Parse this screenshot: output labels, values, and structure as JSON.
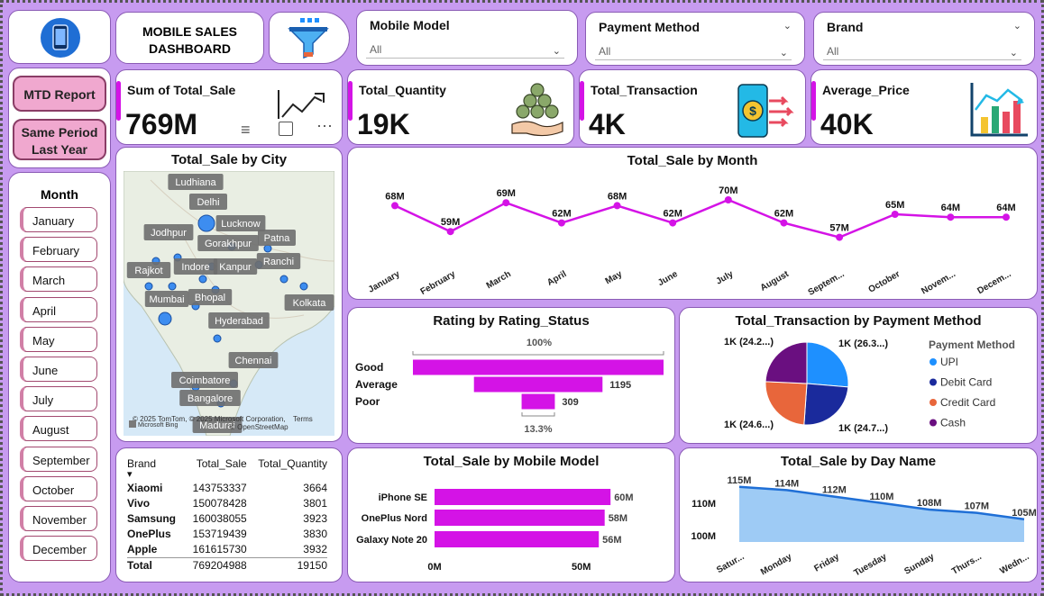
{
  "header": {
    "title_line1": "MOBILE SALES",
    "title_line2": "DASHBOARD"
  },
  "slicers": [
    {
      "label": "Mobile Model",
      "value": "All"
    },
    {
      "label": "Payment Method",
      "value": "All"
    },
    {
      "label": "Brand",
      "value": "All"
    }
  ],
  "nav": {
    "mtd": "MTD Report",
    "spl_line1": "Same Period",
    "spl_line2": "Last Year"
  },
  "month_slicer": {
    "title": "Month",
    "items": [
      "January",
      "February",
      "March",
      "April",
      "May",
      "June",
      "July",
      "August",
      "September",
      "October",
      "November",
      "December"
    ]
  },
  "kpis": [
    {
      "label": "Sum of Total_Sale",
      "value": "769M",
      "icon": "trend-chart-icon"
    },
    {
      "label": "Total_Quantity",
      "value": "19K",
      "icon": "coins-hand-icon"
    },
    {
      "label": "Total_Transaction",
      "value": "4K",
      "icon": "phone-transfer-icon"
    },
    {
      "label": "Average_Price",
      "value": "40K",
      "icon": "bar-growth-icon"
    }
  ],
  "map": {
    "title": "Total_Sale by City",
    "attribution": "© 2025 TomTom, © 2025 Microsoft Corporation,",
    "terms": "Terms",
    "osm": "© OpenStreetMap",
    "bing": "Microsoft Bing",
    "cities": [
      "Ludhiana",
      "Delhi",
      "Lucknow",
      "Jodhpur",
      "Gorakhpur",
      "Patna",
      "Ranchi",
      "Rajkot",
      "Indore",
      "Kanpur",
      "Mumbai",
      "Bhopal",
      "Kolkata",
      "Hyderabad",
      "Chennai",
      "Coimbatore",
      "Bangalore",
      "Madurai"
    ]
  },
  "colors": {
    "accent": "#d413e6",
    "pie": [
      "#1e90ff",
      "#1a2a9c",
      "#e8663b",
      "#6a0f80"
    ],
    "area": "#9ecbf5",
    "area_line": "#1f6fd6"
  },
  "chart_data": [
    {
      "type": "line",
      "title": "Total_Sale by Month",
      "categories": [
        "January",
        "February",
        "March",
        "April",
        "May",
        "June",
        "July",
        "August",
        "Septem...",
        "October",
        "Novem...",
        "Decem..."
      ],
      "values": [
        68,
        59,
        69,
        62,
        68,
        62,
        70,
        62,
        57,
        65,
        64,
        64
      ],
      "unit": "M",
      "labels": [
        "68M",
        "59M",
        "69M",
        "62M",
        "68M",
        "62M",
        "70M",
        "62M",
        "57M",
        "65M",
        "64M",
        "64M"
      ]
    },
    {
      "type": "bar",
      "title": "Rating by Rating_Status",
      "categories": [
        "Good",
        "Average",
        "Poor"
      ],
      "values": [
        2330,
        1195,
        309
      ],
      "value_labels": [
        "",
        "1195",
        "309"
      ],
      "top_annotation": "100%",
      "bottom_annotation": "13.3%"
    },
    {
      "type": "pie",
      "title": "Total_Transaction by Payment Method",
      "legend_title": "Payment Method",
      "categories": [
        "UPI",
        "Debit Card",
        "Credit Card",
        "Cash"
      ],
      "values": [
        26.3,
        24.7,
        24.6,
        24.2
      ],
      "labels": [
        "1K (26.3...)",
        "1K (24.7...)",
        "1K (24.6...)",
        "1K (24.2...)"
      ]
    },
    {
      "type": "bar",
      "title": "Total_Sale by Mobile Model",
      "categories": [
        "iPhone SE",
        "OnePlus Nord",
        "Galaxy Note 20"
      ],
      "values": [
        60,
        58,
        56
      ],
      "labels": [
        "60M",
        "58M",
        "56M"
      ],
      "xticks": [
        "0M",
        "50M"
      ],
      "xlim": [
        0,
        75
      ]
    },
    {
      "type": "area",
      "title": "Total_Sale by Day Name",
      "categories": [
        "Satur...",
        "Monday",
        "Friday",
        "Tuesday",
        "Sunday",
        "Thurs...",
        "Wedn..."
      ],
      "values": [
        115,
        114,
        112,
        110,
        108,
        107,
        105
      ],
      "labels": [
        "115M",
        "114M",
        "112M",
        "110M",
        "108M",
        "107M",
        "105M"
      ],
      "yticks": [
        "110M",
        "100M"
      ],
      "ylim": [
        98,
        118
      ]
    },
    {
      "type": "table",
      "columns": [
        "Brand",
        "Total_Sale",
        "Total_Quantity"
      ],
      "rows": [
        [
          "Xiaomi",
          "143753337",
          "3664"
        ],
        [
          "Vivo",
          "150078428",
          "3801"
        ],
        [
          "Samsung",
          "160038055",
          "3923"
        ],
        [
          "OnePlus",
          "153719439",
          "3830"
        ],
        [
          "Apple",
          "161615730",
          "3932"
        ]
      ],
      "total": [
        "Total",
        "769204988",
        "19150"
      ]
    }
  ]
}
